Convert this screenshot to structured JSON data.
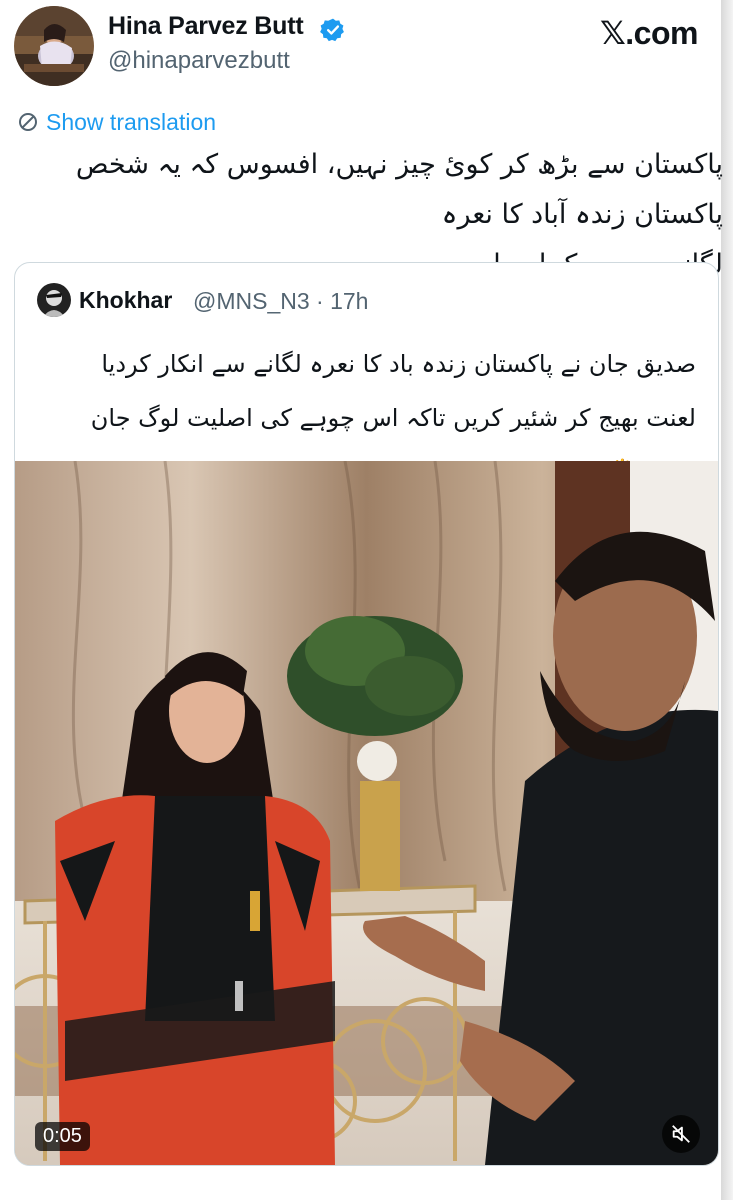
{
  "header": {
    "display_name": "Hina Parvez Butt",
    "handle": "@hinaparvezbutt",
    "brand": "𝕏.com",
    "verified_color": "#1d9bf0"
  },
  "tweet": {
    "show_translation": "Show translation",
    "text_line1": "پاکستان سے بڑھ کر کوئ چیز نہیں، افسوس کہ یہ شخص پاکستان زندہ آباد کا نعرہ",
    "text_line2": "لگانے سے ہچکچا رہا ہے"
  },
  "quoted_tweet": {
    "name": "Khokhar",
    "meta": "@MNS_N3 · 17h",
    "line1": "صدیق جان نے پاکستان زندہ باد کا نعرہ لگانے سے انکار کردیا",
    "line2": "لعنت بھیج کر شئیر کریں تاکہ اس چوہے کی اصلیت لوگ جان سکیں",
    "emoji": "🖐",
    "video": {
      "time": "0:05",
      "icon": "muted-speaker-icon"
    }
  },
  "colors": {
    "link": "#1d9bf0",
    "secondary_text": "#536471",
    "border": "#cfd9de"
  }
}
